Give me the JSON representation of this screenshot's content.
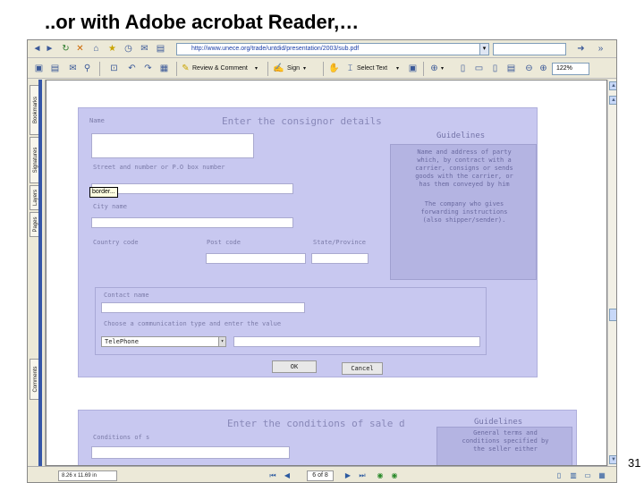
{
  "slide": {
    "title": "..or with Adobe acrobat Reader,…",
    "page_number": "31"
  },
  "browser": {
    "url": "http://www.unece.org/trade/untdid/presentation/2003/sub.pdf",
    "search_value": "",
    "toolbar": {
      "review_label": "Review & Comment",
      "sign_label": "Sign",
      "select_text_label": "Select Text",
      "zoom_value": "122%"
    }
  },
  "nav_tabs": [
    "Bookmarks",
    "Signatures",
    "Layers",
    "Pages",
    "Comments"
  ],
  "form": {
    "name_label": "Name",
    "title": "Enter the consignor details",
    "guidelines_title": "Guidelines",
    "street_label": "Street and number or P.O box number",
    "tooltip": "border...",
    "city_label": "City name",
    "country_label": "Country code",
    "post_label": "Post code",
    "state_label": "State/Province",
    "guidelines_lines": [
      "Name and address of party",
      "which, by contract with a",
      "carrier, consigns or sends",
      "goods with the carrier, or",
      "has them conveyed by him",
      "",
      "The company who gives",
      "forwarding instructions",
      "(also shipper/sender)."
    ],
    "contact_label": "Contact name",
    "comm_label": "Choose a communication type and enter the value",
    "comm_type": "TelePhone",
    "ok_label": "OK",
    "cancel_label": "Cancel"
  },
  "form2": {
    "title": "Enter the conditions of sale d",
    "guidelines_title": "Guidelines",
    "conditions_label": "Conditions of s",
    "guidelines_lines": [
      "General terms and",
      "conditions specified by",
      "the seller either"
    ]
  },
  "status": {
    "page_size": "8.26 x 11.69 in",
    "page_indicator": "6 of 8"
  }
}
